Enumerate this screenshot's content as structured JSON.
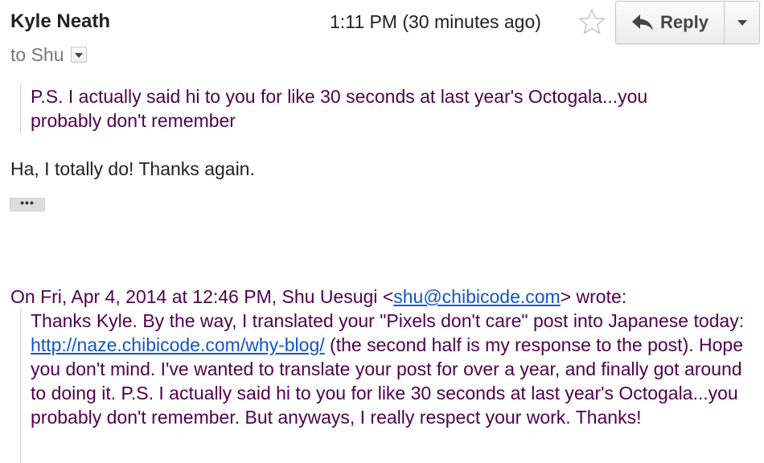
{
  "header": {
    "sender_name": "Kyle Neath",
    "recipient_label": "to Shu",
    "timestamp": "1:11 PM (30 minutes ago)",
    "star_icon": "star-outline-icon",
    "reply_label": "Reply",
    "reply_icon": "reply-arrow-icon",
    "more_icon": "chevron-down-icon"
  },
  "quoted_top": {
    "text": "P.S. I actually said hi to you for like 30 seconds at last year's Octogala...you probably don't remember"
  },
  "body": {
    "text": "Ha, I totally do! Thanks again."
  },
  "trimmed_content_label": "•••",
  "original_message": {
    "attribution_prefix": "On Fri, Apr 4, 2014 at 12:46 PM, Shu Uesugi <",
    "attribution_email": "shu@chibicode.com",
    "attribution_suffix": "> wrote:",
    "text_part1": "Thanks Kyle. By the way, I translated your \"Pixels don't care\" post into Japanese today: ",
    "link": "http://naze.chibicode.com/why-blog/",
    "text_part2": " (the second half is my response to the post). Hope you don't mind. I've wanted to translate your post for over a year, and finally got around to doing it. P.S. I actually said hi to you for like 30 seconds at last year's Octogala...you probably don't remember. But anyways, I really respect your work. Thanks!"
  },
  "colors": {
    "quoted_text": "#500050",
    "body_text": "#222222",
    "link": "#1155cc",
    "muted": "#777777"
  }
}
